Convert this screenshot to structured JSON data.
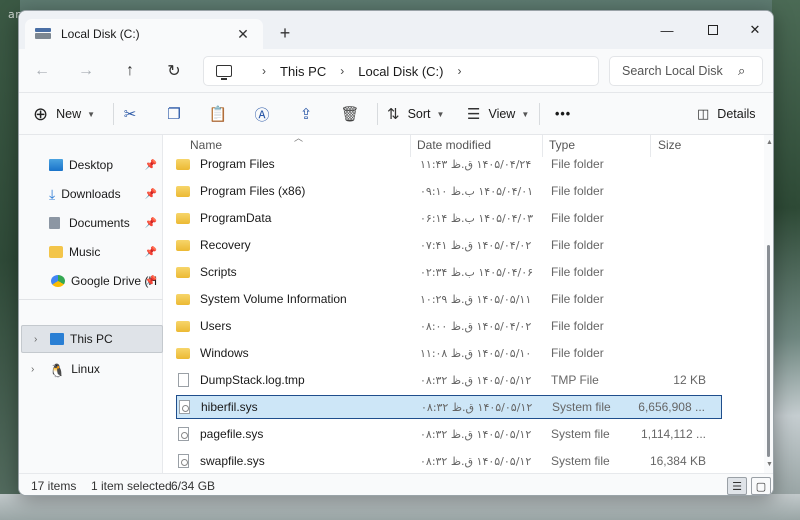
{
  "watermark": "anzalweb.ir",
  "window": {
    "tab_title": "Local Disk (C:)",
    "close_tab": "✕",
    "new_tab": "+"
  },
  "address": {
    "crumbs": [
      "This PC",
      "Local Disk (C:)"
    ],
    "search_placeholder": "Search Local Disk"
  },
  "toolbar": {
    "new_label": "New",
    "sort_label": "Sort",
    "view_label": "View",
    "more_label": "•••",
    "details_label": "Details"
  },
  "sidebar": {
    "items": [
      {
        "label": "Desktop",
        "icon": "desktop-icon",
        "pinned": true
      },
      {
        "label": "Downloads",
        "icon": "downloads-icon",
        "pinned": true
      },
      {
        "label": "Documents",
        "icon": "documents-icon",
        "pinned": true
      },
      {
        "label": "Music",
        "icon": "music-folder-icon",
        "pinned": true
      },
      {
        "label": "Google Drive (H",
        "icon": "google-drive-icon",
        "pinned": true
      },
      {
        "label": "This PC",
        "icon": "this-pc-icon",
        "selected": true
      },
      {
        "label": "Linux",
        "icon": "linux-icon"
      }
    ]
  },
  "columns": {
    "name": "Name",
    "date": "Date modified",
    "type": "Type",
    "size": "Size"
  },
  "files": [
    {
      "name": "Program Files",
      "date": "۱۴۰۵/۰۴/۲۴ ق.ظ ۱۱:۴۳",
      "type": "File folder",
      "size": "",
      "kind": "folder"
    },
    {
      "name": "Program Files (x86)",
      "date": "۱۴۰۵/۰۴/۰۱ ب.ظ ۰۹:۱۰",
      "type": "File folder",
      "size": "",
      "kind": "folder"
    },
    {
      "name": "ProgramData",
      "date": "۱۴۰۵/۰۴/۰۳ ب.ظ ۰۶:۱۴",
      "type": "File folder",
      "size": "",
      "kind": "folder"
    },
    {
      "name": "Recovery",
      "date": "۱۴۰۵/۰۴/۰۲ ق.ظ ۰۷:۴۱",
      "type": "File folder",
      "size": "",
      "kind": "folder"
    },
    {
      "name": "Scripts",
      "date": "۱۴۰۵/۰۴/۰۶ ب.ظ ۰۲:۳۴",
      "type": "File folder",
      "size": "",
      "kind": "folder"
    },
    {
      "name": "System Volume Information",
      "date": "۱۴۰۵/۰۵/۱۱ ق.ظ ۱۰:۲۹",
      "type": "File folder",
      "size": "",
      "kind": "folder"
    },
    {
      "name": "Users",
      "date": "۱۴۰۵/۰۴/۰۲ ق.ظ ۰۸:۰۰",
      "type": "File folder",
      "size": "",
      "kind": "folder"
    },
    {
      "name": "Windows",
      "date": "۱۴۰۵/۰۵/۱۰ ق.ظ ۱۱:۰۸",
      "type": "File folder",
      "size": "",
      "kind": "folder"
    },
    {
      "name": "DumpStack.log.tmp",
      "date": "۱۴۰۵/۰۵/۱۲ ق.ظ ۰۸:۳۲",
      "type": "TMP File",
      "size": "12 KB",
      "kind": "file"
    },
    {
      "name": "hiberfil.sys",
      "date": "۱۴۰۵/۰۵/۱۲ ق.ظ ۰۸:۳۲",
      "type": "System file",
      "size": "6,656,908 ...",
      "kind": "sys",
      "selected": true
    },
    {
      "name": "pagefile.sys",
      "date": "۱۴۰۵/۰۵/۱۲ ق.ظ ۰۸:۳۲",
      "type": "System file",
      "size": "1,114,112 ...",
      "kind": "sys"
    },
    {
      "name": "swapfile.sys",
      "date": "۱۴۰۵/۰۵/۱۲ ق.ظ ۰۸:۳۲",
      "type": "System file",
      "size": "16,384 KB",
      "kind": "sys"
    }
  ],
  "status": {
    "items": "17 items",
    "selected": "1 item selected",
    "size": "6/34 GB"
  },
  "colors": {
    "accent": "#1f4e8c",
    "selection": "#cde6f7",
    "folder": "#f3c54a"
  }
}
